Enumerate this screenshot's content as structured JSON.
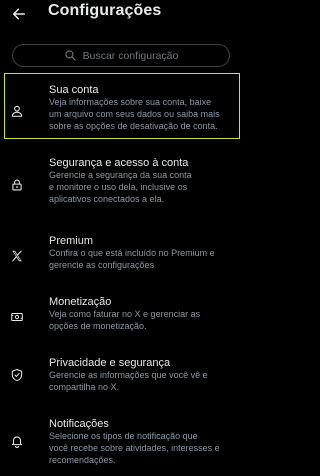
{
  "header": {
    "title": "Configurações",
    "back_icon": "arrow-left-icon"
  },
  "search": {
    "placeholder": "Buscar configuração",
    "icon": "search-icon"
  },
  "colors": {
    "background": "#000000",
    "text_primary": "#e7e9ea",
    "text_secondary": "#8b98a5",
    "selection_outline": "#d4e22a",
    "search_border": "#3b4045"
  },
  "settings": [
    {
      "icon": "user-icon",
      "title": "Sua conta",
      "lines": [
        "Veja informações sobre sua conta, baixe",
        "um arquivo com seus dados ou saiba mais",
        "sobre as opções de desativação de conta."
      ],
      "selected": true
    },
    {
      "icon": "lock-icon",
      "title": "Segurança e acesso à conta",
      "lines": [
        "Gerencie a segurança da sua conta",
        "e monitore o uso dela, inclusive os",
        "aplicativos conectados a ela."
      ],
      "selected": false
    },
    {
      "icon": "x-logo-icon",
      "title": "Premium",
      "lines": [
        "Confira o que está incluído no Premium e",
        "gerencie as configurações"
      ],
      "selected": false
    },
    {
      "icon": "money-icon",
      "title": "Monetização",
      "lines": [
        "Veja como faturar no X e gerenciar as",
        "opções de monetização."
      ],
      "selected": false
    },
    {
      "icon": "shield-icon",
      "title": "Privacidade e segurança",
      "lines": [
        "Gerencie as informações que você vê e",
        "compartilha no X."
      ],
      "selected": false
    },
    {
      "icon": "bell-icon",
      "title": "Notificações",
      "lines": [
        "Selecione os tipos de notificação que",
        "você recebe sobre atividades, interesses e",
        "recomendações."
      ],
      "selected": false
    }
  ]
}
